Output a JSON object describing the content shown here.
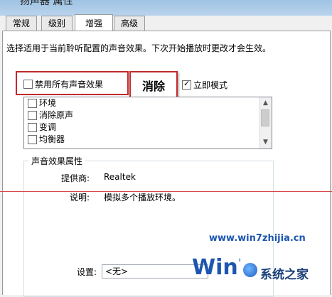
{
  "window": {
    "title": "扬声器 属性"
  },
  "tabs": [
    {
      "label": "常规",
      "active": false
    },
    {
      "label": "级别",
      "active": false
    },
    {
      "label": "增强",
      "active": true
    },
    {
      "label": "高级",
      "active": false
    }
  ],
  "enhancements": {
    "description": "选择适用于当前聆听配置的声音效果。下次开始播放时更改才会生效。",
    "disable_all_label": "禁用所有声音效果",
    "disable_all_checked": false,
    "clear_callout": "消除",
    "immediate_label": "立即模式",
    "immediate_checked": true,
    "effects": [
      {
        "label": "环境",
        "checked": false
      },
      {
        "label": "消除原声",
        "checked": false
      },
      {
        "label": "变调",
        "checked": false
      },
      {
        "label": "均衡器",
        "checked": false
      }
    ]
  },
  "properties": {
    "group_title": "声音效果属性",
    "provider_label": "提供商:",
    "provider_value": "Realtek",
    "description_label": "说明:",
    "description_value": "模拟多个播放环境。",
    "setting_label": "设置:",
    "setting_value": "<无>"
  },
  "watermark": {
    "url": "www.win7zhijia.cn",
    "site_name": "系统之家",
    "logo_text": "Win7"
  },
  "colors": {
    "highlight_border": "#c0292b",
    "watermark_blue": "#1c56b0"
  }
}
